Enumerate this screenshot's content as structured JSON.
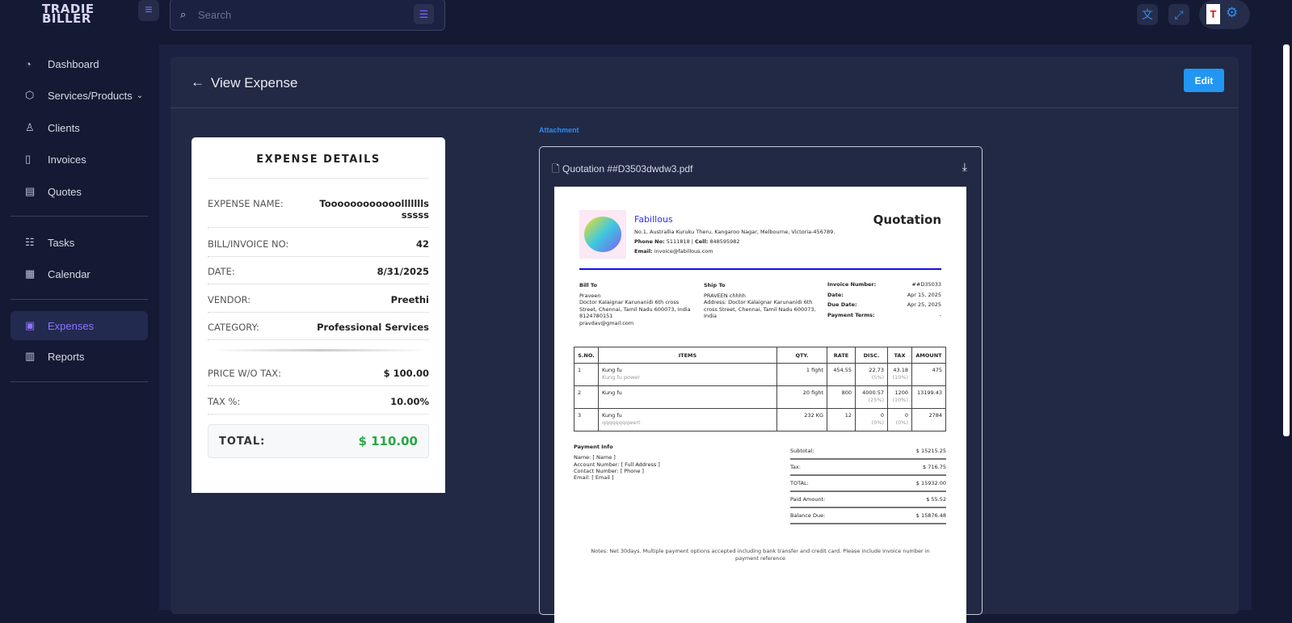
{
  "app": {
    "logo_line1": "TRADIE",
    "logo_line2": "BILLER",
    "search_placeholder": "Search"
  },
  "sidebar": {
    "items": [
      {
        "label": "Dashboard",
        "icon": "gauge-icon"
      },
      {
        "label": "Services/Products",
        "icon": "box-icon",
        "chevron": "⌄"
      },
      {
        "label": "Clients",
        "icon": "user-icon"
      },
      {
        "label": "Invoices",
        "icon": "file-icon"
      },
      {
        "label": "Quotes",
        "icon": "file-text-icon"
      },
      {
        "label": "Tasks",
        "icon": "tasks-icon"
      },
      {
        "label": "Calendar",
        "icon": "calendar-icon"
      },
      {
        "label": "Expenses",
        "icon": "expense-icon"
      },
      {
        "label": "Reports",
        "icon": "chart-icon"
      }
    ]
  },
  "header": {
    "title": "View Expense",
    "edit_label": "Edit"
  },
  "expense": {
    "heading": "EXPENSE DETAILS",
    "fields": [
      {
        "label": "EXPENSE NAME:",
        "value": "Toooooooooooolllllllssssss"
      },
      {
        "label": "BILL/INVOICE NO:",
        "value": "42"
      },
      {
        "label": "DATE:",
        "value": "8/31/2025"
      },
      {
        "label": "VENDOR:",
        "value": "Preethi"
      },
      {
        "label": "CATEGORY:",
        "value": "Professional Services"
      },
      {
        "label": "PRICE W/O TAX:",
        "value": "$ 100.00"
      },
      {
        "label": "TAX %:",
        "value": "10.00%"
      }
    ],
    "total_label": "TOTAL:",
    "total_value": "$ 110.00"
  },
  "attachment": {
    "label": "Attachment",
    "filename": "Quotation ##D3503dwdw3.pdf"
  },
  "quotation": {
    "company": "Fabillous",
    "address": "No.1, Australlia Kuruku Theru, Kangaroo Nagar, Melbourne, Victoria-456789.",
    "phone_label": "Phone No:",
    "phone": "5111818",
    "cell_label": "Cell:",
    "cell": "848595982",
    "email_label": "Email:",
    "email": "invoice@fabillous.com",
    "title": "Quotation",
    "bill_to_label": "Bill To",
    "bill_to": [
      "Praveen",
      "Doctor Kalaignar Karunanidi 6th cross Street, Chennai, Tamil Nadu 600073, India",
      "8124780151",
      "pravdav@gmail.com"
    ],
    "ship_to_label": "Ship To",
    "ship_to": [
      "PRAVEEN chhhh",
      "Address: Doctor Kalaignar Karunanidi 6th cross Street, Chennai, Tamil Nadu 600073, India"
    ],
    "meta": [
      {
        "label": "Invoice Number:",
        "value": "##D35033"
      },
      {
        "label": "Date:",
        "value": "Apr 15, 2025"
      },
      {
        "label": "Due Date:",
        "value": "Apr 25, 2025"
      },
      {
        "label": "Payment Terms:",
        "value": "-"
      }
    ],
    "columns": [
      "S.NO.",
      "ITEMS",
      "QTY.",
      "RATE",
      "DISC.",
      "TAX",
      "AMOUNT"
    ],
    "rows": [
      {
        "sno": "1",
        "item": "Kung fu",
        "desc": "Kung fu power",
        "qty": "1 fight",
        "rate": "454.55",
        "disc": "22.73",
        "disc_pct": "(5%)",
        "tax": "43.18",
        "tax_pct": "(10%)",
        "amount": "475"
      },
      {
        "sno": "2",
        "item": "Kung fu",
        "desc": "",
        "qty": "20 fight",
        "rate": "800",
        "disc": "4000.57",
        "disc_pct": "(25%)",
        "tax": "1200",
        "tax_pct": "(10%)",
        "amount": "13199.43"
      },
      {
        "sno": "3",
        "item": "Kung fu",
        "desc": "qqqqqqqqwert",
        "qty": "232 KG",
        "rate": "12",
        "disc": "0",
        "disc_pct": "(0%)",
        "tax": "0",
        "tax_pct": "(0%)",
        "amount": "2784"
      }
    ],
    "payment_info_label": "Payment Info",
    "payment_info": [
      "Name: [ Name ]",
      "Account Number: [ Full Address ]",
      "Contact Number: [ Phone ]",
      "Email: [ Email ]"
    ],
    "summary": [
      {
        "label": "Subtotal:",
        "value": "$ 15215.25"
      },
      {
        "label": "Tax:",
        "value": "$ 716.75"
      },
      {
        "label": "TOTAL:",
        "value": "$ 15932.00"
      },
      {
        "label": "Paid Amount:",
        "value": "$ 55.52"
      },
      {
        "label": "Balance Due:",
        "value": "$ 15876.48"
      }
    ],
    "notes": "Notes: Net 30days. Multiple payment options accepted including bank transfer and credit card. Please include invoice number in payment reference"
  }
}
